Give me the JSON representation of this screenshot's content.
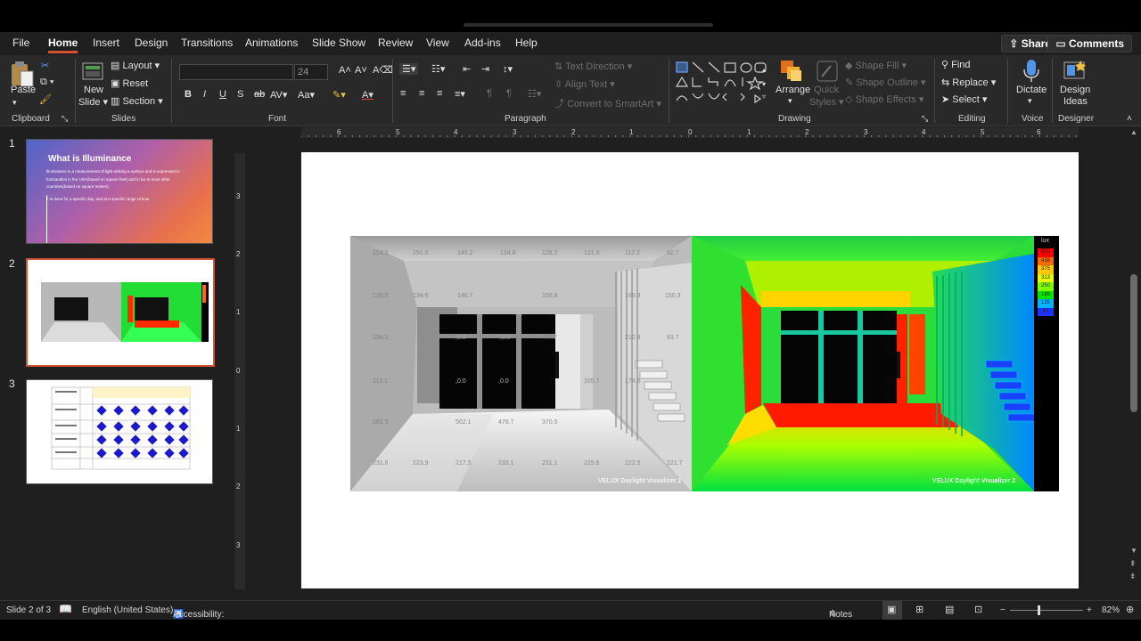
{
  "menu": {
    "tabs": [
      "File",
      "Home",
      "Insert",
      "Design",
      "Transitions",
      "Animations",
      "Slide Show",
      "Review",
      "View",
      "Add-ins",
      "Help"
    ],
    "active": "Home",
    "share_label": "Share",
    "comments_label": "Comments"
  },
  "ribbon": {
    "clipboard": {
      "paste": "Paste",
      "label": "Clipboard"
    },
    "slides": {
      "new_slide_1": "New",
      "new_slide_2": "Slide",
      "layout": "Layout",
      "reset": "Reset",
      "section": "Section",
      "label": "Slides"
    },
    "font": {
      "font_name": "",
      "font_size": "24",
      "label": "Font"
    },
    "paragraph": {
      "text_direction": "Text Direction",
      "align_text": "Align Text",
      "convert_smartart": "Convert to SmartArt",
      "label": "Paragraph"
    },
    "drawing": {
      "arrange": "Arrange",
      "quick_styles_1": "Quick",
      "quick_styles_2": "Styles",
      "shape_fill": "Shape Fill",
      "shape_outline": "Shape Outline",
      "shape_effects": "Shape Effects",
      "label": "Drawing"
    },
    "editing": {
      "find": "Find",
      "replace": "Replace",
      "select": "Select",
      "label": "Editing"
    },
    "voice": {
      "dictate": "Dictate",
      "label": "Voice"
    },
    "designer": {
      "design_ideas_1": "Design",
      "design_ideas_2": "Ideas",
      "label": "Designer"
    }
  },
  "ruler": {
    "h_ticks": [
      "6",
      "5",
      "4",
      "3",
      "2",
      "1",
      "0",
      "1",
      "2",
      "3",
      "4",
      "5",
      "6"
    ],
    "v_ticks": [
      "3",
      "2",
      "1",
      "0",
      "1",
      "2",
      "3"
    ]
  },
  "thumbnails": [
    {
      "num": "1",
      "title": "What is Illuminance",
      "bullet1": "Illuminance is a measurement of light striking a surface and is expressed in footcandles in the USA(based on square feet) and in lux in most other countries(based on square meters).",
      "bullet2": "It is done for a specific day, and at a specific range of time"
    },
    {
      "num": "2"
    },
    {
      "num": "3"
    }
  ],
  "slide": {
    "left_watermark": "VELUX Daylight Visualizer 2",
    "right_watermark": "VELUX Daylight Visualizer 2",
    "legend_title": "lux",
    "legend_values": [
      "500",
      "438",
      "375",
      "313",
      "250",
      "188",
      "125",
      "63"
    ],
    "legend_colors": [
      "#ff0000",
      "#ff6a00",
      "#ffc800",
      "#e6ff00",
      "#7dff00",
      "#00e600",
      "#00b4ff",
      "#1e32ff"
    ],
    "gray_values": [
      "154.5",
      "151.0",
      "145.2",
      "134.8",
      "128.2",
      "121.0",
      "112.2",
      "82.7",
      "126.5",
      "134.6",
      "146.7",
      "156.8",
      "169.3",
      "150.3",
      "154.0",
      ",0.0",
      ",0.0",
      "77.7",
      "212.8",
      "83.7",
      "113.1",
      ",0.0",
      ",0.0",
      "105.7",
      "174.6",
      "502.1",
      "478.7",
      "370.5",
      "281.5",
      "223.9",
      "231.6",
      "217.5",
      "233.1",
      "231.1",
      "229.6",
      "222.5",
      "221.7"
    ]
  },
  "status": {
    "slide_info": "Slide 2 of 3",
    "language": "English (United States)",
    "accessibility": "Accessibility: Investigate",
    "notes": "Notes",
    "zoom": "82%"
  }
}
